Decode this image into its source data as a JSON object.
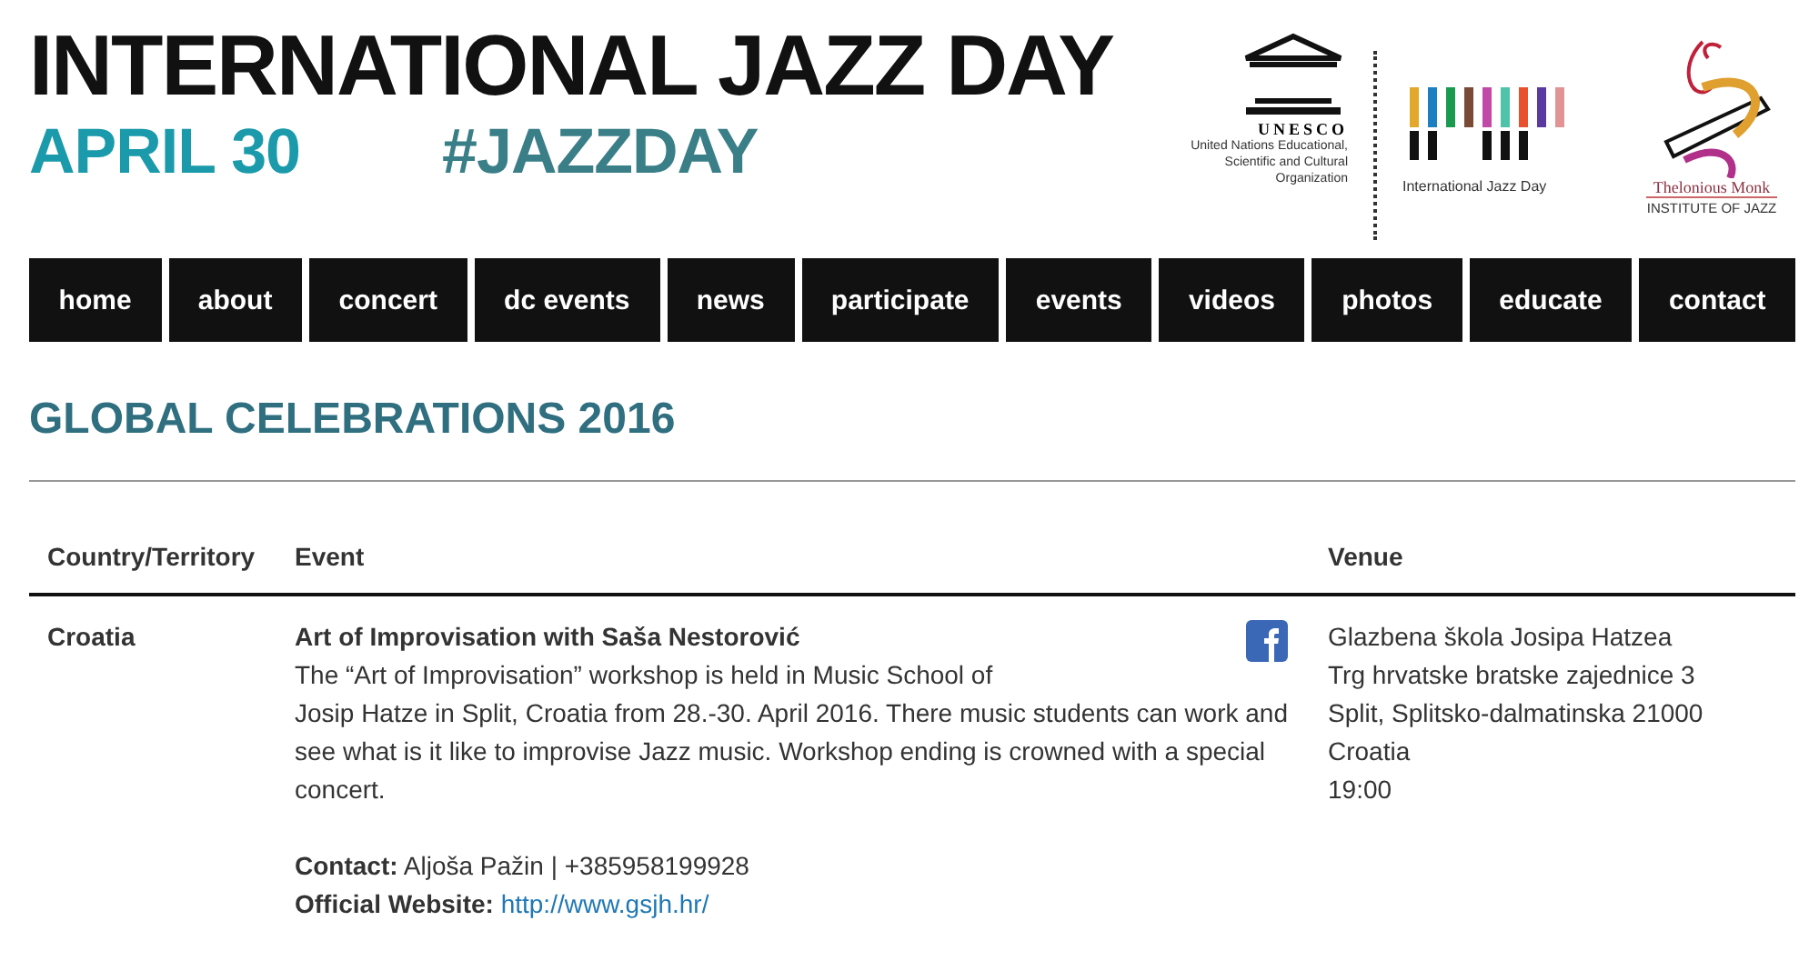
{
  "header": {
    "title": "INTERNATIONAL JAZZ DAY",
    "date": "APRIL 30",
    "hashtag": "#JAZZDAY",
    "unesco": {
      "mark": "UNESCO",
      "caption": "United Nations Educational, Scientific and Cultural Organization"
    },
    "jazz_day_logo": {
      "caption": "International Jazz Day"
    },
    "monk_logo": {
      "name": "Thelonious Monk",
      "subtitle": "INSTITUTE OF JAZZ"
    }
  },
  "nav": [
    {
      "label": "home"
    },
    {
      "label": "about"
    },
    {
      "label": "concert"
    },
    {
      "label": "dc events"
    },
    {
      "label": "news"
    },
    {
      "label": "participate"
    },
    {
      "label": "events"
    },
    {
      "label": "videos"
    },
    {
      "label": "photos"
    },
    {
      "label": "educate"
    },
    {
      "label": "contact"
    }
  ],
  "heading": "GLOBAL CELEBRATIONS 2016",
  "table": {
    "columns": [
      "Country/Territory",
      "Event",
      "Venue"
    ],
    "rows": [
      {
        "country": "Croatia",
        "event_title": "Art of Improvisation with Saša Nestorović",
        "description": "The “Art of Improvisation” workshop is held in Music School of Josip Hatze in Split, Croatia from 28.-30. April 2016. There music students can work and see what is it like to improvise Jazz music. Workshop ending is crowned with a special concert.",
        "contact_label": "Contact:",
        "contact": "Aljoša Pažin | +385958199928",
        "website_label": "Official Website:",
        "website": "http://www.gsjh.hr/",
        "venue": [
          "Glazbena škola Josipa Hatzea",
          "Trg hrvatske bratske zajednice 3",
          "Split, Splitsko-dalmatinska 21000",
          "Croatia",
          "19:00"
        ]
      }
    ]
  }
}
